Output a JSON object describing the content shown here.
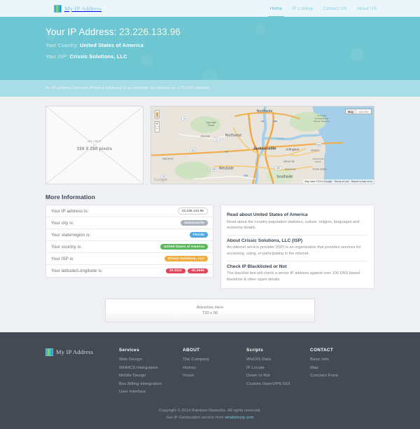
{
  "site": {
    "brand_name": "My IP Address",
    "logo_icon": "colored-bars-icon"
  },
  "nav": {
    "items": [
      {
        "label": "Home",
        "active": true
      },
      {
        "label": "IP Lookup",
        "active": false
      },
      {
        "label": "Contact US",
        "active": false
      },
      {
        "label": "About US",
        "active": false
      }
    ]
  },
  "hero": {
    "ip_label": "Your IP Address: ",
    "ip_value": "23.226.133.96",
    "country_label": "Your Country: ",
    "country_value": "United States of America",
    "isp_label": "Your ISP: ",
    "isp_value": "Crissic Solutions, LLC",
    "background_color": "#6ec6d2"
  },
  "info_strip": {
    "text": "An IP address (Internet Protocol Address) is an identifier for devices on a TCP/IP network.",
    "background_color": "#a8dde5"
  },
  "ad_unit": {
    "title": "AD UNIT",
    "size": "336 X 280 pixels"
  },
  "map": {
    "toggle_map": "Map",
    "toggle_satellite": "Satellite",
    "zoom_in": "+",
    "zoom_out": "−",
    "watermark": "Google",
    "attribution": "Map data ©2014 Google",
    "terms": "Terms of Use",
    "report": "Report a map error",
    "labels": [
      "Northside",
      "Northwest",
      "Jacksonville",
      "Arlington",
      "Westside",
      "Southside",
      "Ponte Vedra",
      "Windy Hill",
      "Deerwood",
      "Bryceville",
      "Macclenny",
      "Beaches",
      "Jacksonville Beach",
      "Cary State Forest",
      "Timucuan Ecological and Historic Preserve"
    ]
  },
  "more_information": {
    "heading": "More Information",
    "rows": [
      {
        "label": "Your IP address is:",
        "values": [
          {
            "text": "23.226.133.96",
            "color": "plain"
          }
        ]
      },
      {
        "label": "Your city is:",
        "values": [
          {
            "text": "Jacksonville",
            "color": "gray"
          }
        ]
      },
      {
        "label": "Your state/region is:",
        "values": [
          {
            "text": "Florida",
            "color": "blue"
          }
        ]
      },
      {
        "label": "Your country is:",
        "values": [
          {
            "text": "United States of America",
            "color": "green"
          }
        ]
      },
      {
        "label": "Your ISP is:",
        "values": [
          {
            "text": "Crissic Solutions, LLC",
            "color": "orange"
          }
        ]
      },
      {
        "label": "Your latitude/Longitude is:",
        "values": [
          {
            "text": "30.3322",
            "color": "red"
          },
          {
            "text": "-81.6556",
            "color": "red"
          }
        ]
      }
    ]
  },
  "side_panel": {
    "sections": [
      {
        "title": "Read about United States of America",
        "body": "Read about the country population statistics, culture, religion, languages and economy details."
      },
      {
        "title": "About Crissic Solutions, LLC (ISP)",
        "body": "An internet service provider (ISP) is an organization that provides services for accessing, using, or participating in the internet."
      },
      {
        "title": "Check IP Blacklisted or Not",
        "body": "The blacklist test will check a server IP address against over 100 DNS based blacklists & other spam details."
      }
    ]
  },
  "advertise": {
    "line1": "Advertise Here",
    "line2": "720 x 90"
  },
  "footer": {
    "brand_name": "My IP Address",
    "columns": [
      {
        "heading": "Services",
        "links": [
          "Web Design",
          "WHMCS intergration",
          "Mobile Design",
          "Box Billing intergration",
          "User Interface"
        ]
      },
      {
        "heading": "ABOUT",
        "links": [
          "The Company",
          "History",
          "Vision"
        ]
      },
      {
        "heading": "Scripts",
        "links": [
          "WHOIS Data",
          "IP Locate",
          "Down or Not",
          "Custom OpenVPN GUI"
        ]
      },
      {
        "heading": "CONTACT",
        "links": [
          "Basic Info",
          "Map",
          "Conctact Form"
        ]
      }
    ],
    "copyright": "Copyright © 2014 Rainbow Networks. All rights reserved.",
    "credit_prefix": "Get IP Geolocation service from ",
    "credit_link": "whatismyip.com"
  }
}
